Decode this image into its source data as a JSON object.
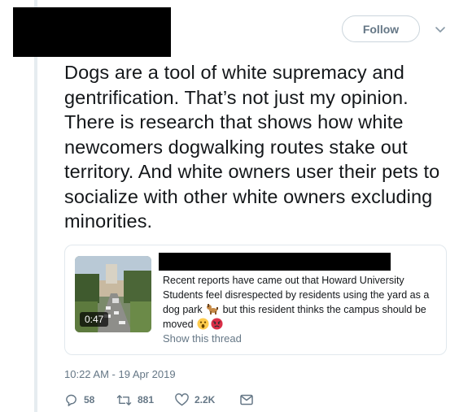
{
  "header": {
    "follow_label": "Follow",
    "caret_icon": "chevron-down-icon"
  },
  "tweet": {
    "text": "Dogs are a tool of white supremacy and gentrification. That’s not just my opinion. There is research that shows how white newcomers dogwalking routes stake out territory. And white owners user their pets to socialize with other white owners excluding minorities.",
    "timestamp": "10:22 AM - 19 Apr 2019"
  },
  "quoted": {
    "video_duration": "0:47",
    "text_part1": "Recent reports have came out that Howard University Students feel disrespected by residents using the yard as a dog park ",
    "text_part2": " but this resident thinks the campus should be moved ",
    "emoji_1": "dog-emoji",
    "emoji_2": "astonished-face-emoji",
    "emoji_3": "angry-face-emoji",
    "show_thread": "Show this thread"
  },
  "actions": {
    "replies": "58",
    "retweets": "881",
    "likes": "2.2K",
    "icons": [
      "reply-icon",
      "retweet-icon",
      "like-icon",
      "message-icon"
    ]
  },
  "colors": {
    "text": "#14171a",
    "muted": "#657786",
    "border": "#e1e8ed",
    "thread_line": "#e6ecf0"
  }
}
